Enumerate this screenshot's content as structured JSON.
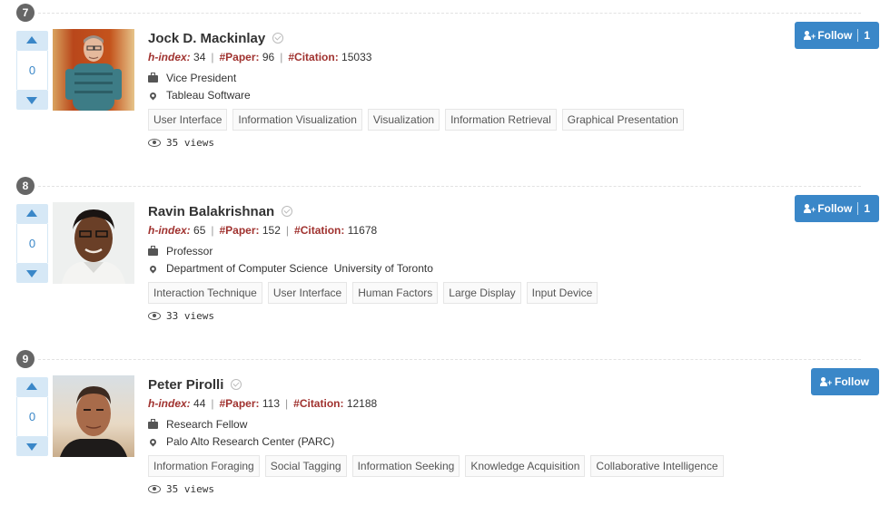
{
  "entries": [
    {
      "rank": "7",
      "vote_count": "0",
      "name": "Jock D. Mackinlay",
      "hindex_label": "h-index:",
      "hindex": "34",
      "paper_label": "#Paper:",
      "paper": "96",
      "citation_label": "#Citation:",
      "citation": "15033",
      "position": "Vice President",
      "organization": "Tableau Software",
      "tags": [
        "User Interface",
        "Information Visualization",
        "Visualization",
        "Information Retrieval",
        "Graphical Presentation"
      ],
      "views": "35 views",
      "follow_label": "Follow",
      "follow_count": "1"
    },
    {
      "rank": "8",
      "vote_count": "0",
      "name": "Ravin Balakrishnan",
      "hindex_label": "h-index:",
      "hindex": "65",
      "paper_label": "#Paper:",
      "paper": "152",
      "citation_label": "#Citation:",
      "citation": "11678",
      "position": "Professor",
      "organization": "Department of Computer Science  University of Toronto",
      "tags": [
        "Interaction Technique",
        "User Interface",
        "Human Factors",
        "Large Display",
        "Input Device"
      ],
      "views": "33 views",
      "follow_label": "Follow",
      "follow_count": "1"
    },
    {
      "rank": "9",
      "vote_count": "0",
      "name": "Peter Pirolli",
      "hindex_label": "h-index:",
      "hindex": "44",
      "paper_label": "#Paper:",
      "paper": "113",
      "citation_label": "#Citation:",
      "citation": "12188",
      "position": "Research Fellow",
      "organization": "Palo Alto Research Center (PARC)",
      "tags": [
        "Information Foraging",
        "Social Tagging",
        "Information Seeking",
        "Knowledge Acquisition",
        "Collaborative Intelligence"
      ],
      "views": "35 views",
      "follow_label": "Follow",
      "follow_count": ""
    }
  ],
  "colors": {
    "accent": "#3a87c8",
    "metric_label": "#a0322f",
    "rank_badge": "#666666",
    "vote_bg": "#d6e8f6"
  },
  "icons": [
    "vote-up-icon",
    "vote-down-icon",
    "verified-check-icon",
    "briefcase-icon",
    "map-marker-icon",
    "eye-icon",
    "user-plus-icon"
  ]
}
